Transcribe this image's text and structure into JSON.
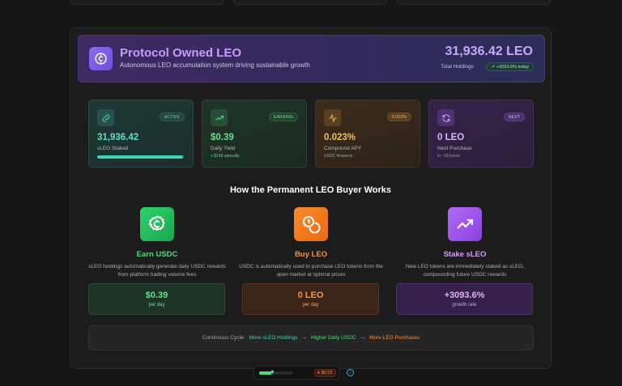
{
  "hero": {
    "title": "Protocol Owned LEO",
    "subtitle": "Autonomous LEO accumulation system driving sustainable growth",
    "total_value": "31,936.42 LEO",
    "total_label": "Total Holdings",
    "change_badge": "+3093.6% today"
  },
  "stats": [
    {
      "value": "31,936.42",
      "label": "sLEO Staked",
      "badge": "ACTIVE",
      "sub": "",
      "progress": 0.98,
      "color": "#3fd6b8",
      "icon": "link-icon"
    },
    {
      "value": "$0.39",
      "label": "Daily Yield",
      "badge": "EARNING",
      "sub": "+ $143 annually",
      "color": "#4ade80",
      "icon": "trending-up-icon"
    },
    {
      "value": "0.023%",
      "label": "Compound APY",
      "badge": "0.023%",
      "sub": "USDC Rewards",
      "color": "#f2b648",
      "icon": "activity-icon"
    },
    {
      "value": "0 LEO",
      "label": "Next Purchase",
      "badge": "NEXT",
      "sub": "In ~18 hours",
      "color": "#d7a4ff",
      "icon": "refresh-icon"
    }
  ],
  "section_title": "How the Permanent LEO Buyer Works",
  "steps": [
    {
      "title": "Earn USDC",
      "desc": "sLEO holdings automatically generate daily USDC rewards from platform trading volume fees",
      "box_value": "$0.39",
      "box_sub": "per day",
      "color": "#4ade80",
      "icon": "usdc-coin-icon"
    },
    {
      "title": "Buy LEO",
      "desc": "USDC is automatically used to purchase LEO tokens from the open market at optimal prices",
      "box_value": "0 LEO",
      "box_sub": "per day",
      "color": "#fb923c",
      "icon": "coins-icon"
    },
    {
      "title": "Stake sLEO",
      "desc": "New LEO tokens are immediately staked as sLEO, compounding future USDC rewards",
      "box_value": "+3093.6%",
      "box_sub": "growth rate",
      "color": "#d59bff",
      "icon": "trending-up-icon"
    }
  ],
  "cycle": {
    "label": "Continuous Cycle:",
    "items": [
      "More sLEO Holdings",
      "Higher Daily USDC",
      "More LEO Purchases"
    ],
    "arrow": "→"
  },
  "bottom_bar": {
    "progress": 0.35,
    "price": "$0.02"
  }
}
